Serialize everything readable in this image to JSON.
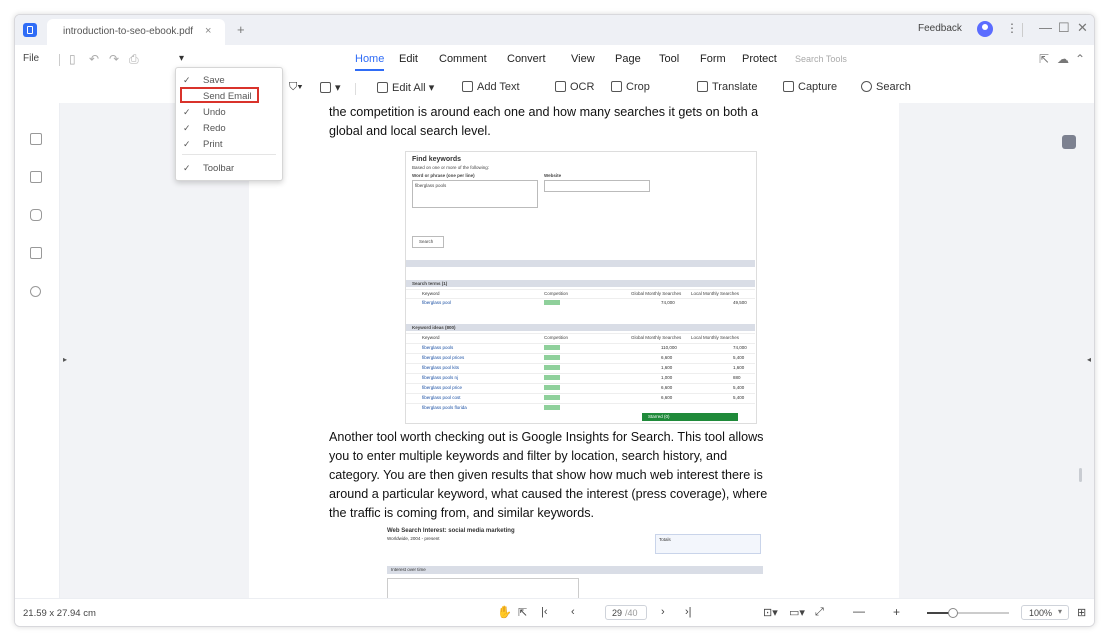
{
  "window": {
    "tab_title": "introduction-to-seo-ebook.pdf",
    "tab_close": "×",
    "tab_add": "+",
    "feedback": "Feedback",
    "more": "⋮",
    "minimize": "—",
    "maximize": "☐",
    "close": "✕"
  },
  "menu": {
    "file": "File",
    "tabs": [
      "Home",
      "Edit",
      "Comment",
      "Convert",
      "View",
      "Page",
      "Tool",
      "Form",
      "Protect"
    ],
    "search_tools": "Search Tools"
  },
  "toolbar": {
    "edit_all": "Edit All",
    "add_text": "Add Text",
    "ocr": "OCR",
    "crop": "Crop",
    "translate": "Translate",
    "capture": "Capture",
    "search": "Search"
  },
  "dropdown": {
    "items": [
      {
        "label": "Save",
        "checked": true
      },
      {
        "label": "Send Email",
        "checked": false
      },
      {
        "label": "Undo",
        "checked": true
      },
      {
        "label": "Redo",
        "checked": true
      },
      {
        "label": "Print",
        "checked": true
      },
      {
        "label": "Toolbar",
        "checked": true
      }
    ],
    "check_glyph": "✓"
  },
  "document": {
    "para1_line1": "the competition is around each one and how many searches it gets on both a",
    "para1_line2": "global and local search level.",
    "para2_lines": [
      "Another tool worth checking out is Google Insights for Search. This tool allows",
      "you to enter multiple keywords and filter by location, search history, and",
      "category. You are then given results that show how much web interest there is",
      "around a particular keyword, what caused the interest (press coverage), where",
      "the traffic is coming from, and similar keywords."
    ],
    "fig1": {
      "title": "Find keywords",
      "subtitle": "Based on one or more of the following:",
      "word_label": "Word or phrase (one per line)",
      "website_label": "Website",
      "word_value": "fiberglass pools",
      "search_btn": "Search",
      "search_terms_header": "Search terms (1)",
      "col_keyword": "Keyword",
      "col_competition": "Competition",
      "col_global": "Global Monthly Searches",
      "col_local": "Local Monthly Searches",
      "term_row": {
        "keyword": "fiberglass pool",
        "global": "74,000",
        "local": "49,500"
      },
      "ideas_header": "Keyword ideas (800)",
      "ideas": [
        {
          "keyword": "fiberglass pools",
          "global": "110,000",
          "local": "74,000"
        },
        {
          "keyword": "fiberglass pool prices",
          "global": "6,600",
          "local": "5,400"
        },
        {
          "keyword": "fiberglass pool kits",
          "global": "1,600",
          "local": "1,600"
        },
        {
          "keyword": "fiberglass pools nj",
          "global": "1,000",
          "local": "880"
        },
        {
          "keyword": "fiberglass pool price",
          "global": "6,600",
          "local": "5,400"
        },
        {
          "keyword": "fiberglass pool cost",
          "global": "6,600",
          "local": "5,400"
        },
        {
          "keyword": "fiberglass pools florida",
          "global": "",
          "local": ""
        }
      ],
      "starred": "Starred (0)"
    },
    "fig2": {
      "title": "Web Search Interest: social media marketing",
      "sub": "Worldwide, 2004 - present",
      "totals": "Totals",
      "interest": "Interest over time"
    }
  },
  "status": {
    "page_size": "21.59 x 27.94 cm",
    "page_current": "29",
    "page_total": "/40",
    "zoom": "100%",
    "zoom_fraction": 0.3
  }
}
